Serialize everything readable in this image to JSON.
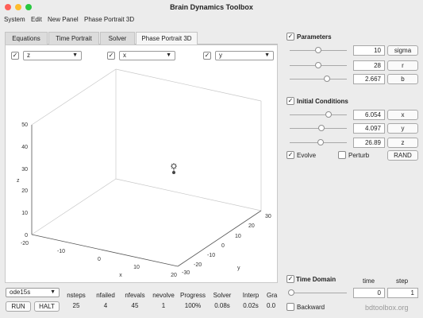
{
  "window": {
    "title": "Brain Dynamics Toolbox"
  },
  "menu": [
    "System",
    "Edit",
    "New Panel",
    "Phase Portrait 3D"
  ],
  "tabs": [
    "Equations",
    "Time Portrait",
    "Solver",
    "Phase Portrait 3D"
  ],
  "axis_selectors": [
    {
      "value": "z",
      "checked": true
    },
    {
      "value": "x",
      "checked": true
    },
    {
      "value": "y",
      "checked": true
    }
  ],
  "plot": {
    "z_ticks": [
      "0",
      "10",
      "20",
      "30",
      "40",
      "50"
    ],
    "x_ticks": [
      "-20",
      "-10",
      "0",
      "10",
      "20"
    ],
    "y_ticks": [
      "-30",
      "-20",
      "-10",
      "0",
      "10",
      "20",
      "30"
    ],
    "zlabel": "z",
    "xlabel": "x",
    "ylabel": "y",
    "marker": {
      "x": 6.054,
      "y": 4.097,
      "z": 26.89
    }
  },
  "parameters": {
    "title": "Parameters",
    "checked": true,
    "rows": [
      {
        "value": "10",
        "button": "sigma",
        "slider": 0.5
      },
      {
        "value": "28",
        "button": "r",
        "slider": 0.5
      },
      {
        "value": "2.667",
        "button": "b",
        "slider": 0.65
      }
    ]
  },
  "initial": {
    "title": "Initial Conditions",
    "checked": true,
    "rows": [
      {
        "value": "6.054",
        "button": "x",
        "slider": 0.68
      },
      {
        "value": "4.097",
        "button": "y",
        "slider": 0.56
      },
      {
        "value": "26.89",
        "button": "z",
        "slider": 0.54
      }
    ],
    "evolve_label": "Evolve",
    "evolve_checked": true,
    "perturb_label": "Perturb",
    "perturb_checked": false,
    "rand_label": "RAND"
  },
  "time_domain": {
    "title": "Time Domain",
    "checked": true,
    "time_header": "time",
    "step_header": "step",
    "time_value": "0",
    "step_value": "1",
    "backward_label": "Backward",
    "backward_checked": false,
    "slider": 0.0
  },
  "solver": {
    "selected": "ode15s",
    "run_label": "RUN",
    "halt_label": "HALT",
    "stats": [
      {
        "header": "nsteps",
        "value": "25"
      },
      {
        "header": "nfailed",
        "value": "4"
      },
      {
        "header": "nfevals",
        "value": "45"
      },
      {
        "header": "nevolve",
        "value": "1"
      },
      {
        "header": "Progress",
        "value": "100%"
      },
      {
        "header": "Solver",
        "value": "0.08s"
      },
      {
        "header": "Interp",
        "value": "0.02s"
      },
      {
        "header": "Gra",
        "value": "0.0"
      }
    ]
  },
  "footer": "bdtoolbox.org",
  "colors": {
    "close": "#ff5f57",
    "minimize": "#febc2e",
    "zoom": "#28c840"
  }
}
